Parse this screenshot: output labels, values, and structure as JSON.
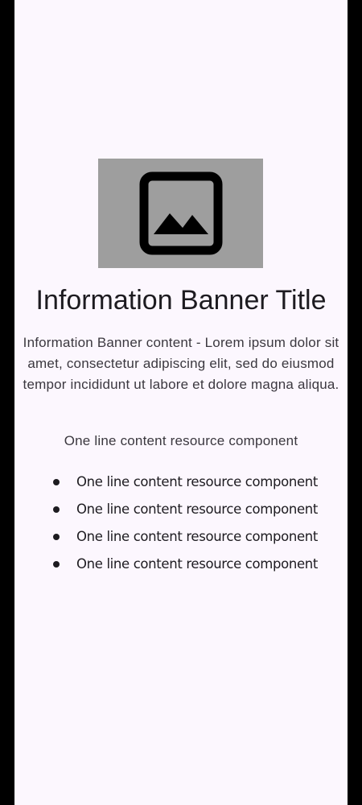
{
  "banner": {
    "image_icon": "image-placeholder-icon",
    "image_bg_color": "#9e9e9e",
    "title": "Information Banner Title",
    "content": "Information Banner content - Lorem ipsum dolor sit amet, consectetur adipiscing elit, sed do eiusmod tempor incididunt ut labore et dolore magna aliqua.",
    "resource_line": "One line content resource component",
    "bullets": [
      "One line content resource component",
      "One line content resource component",
      "One line content resource component",
      "One line content resource component"
    ]
  },
  "colors": {
    "background": "#fcf7fe",
    "text": "#1d1b20"
  }
}
